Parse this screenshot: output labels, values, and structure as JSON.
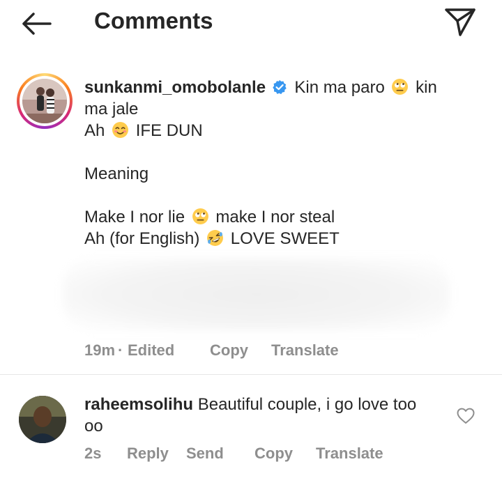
{
  "header": {
    "title": "Comments",
    "back_icon": "arrow-left-icon",
    "send_icon": "paper-plane-icon"
  },
  "post_comment": {
    "username": "sunkanmi_omobolanle",
    "verified": true,
    "text_part1": "Kin ma paro",
    "text_part2": "kin",
    "line2": "ma jale",
    "line3_a": "Ah",
    "line3_b": "IFE DUN",
    "line5": "Meaning",
    "line7_a": "Make I nor lie",
    "line7_b": "make I nor steal",
    "line8_a": "Ah (for English)",
    "line8_b": "LOVE SWEET",
    "emojis": [
      "rolling-eyes-emoji",
      "smiling-face-emoji",
      "rolling-eyes-emoji",
      "rofl-emoji"
    ],
    "time": "19m",
    "separator": "·",
    "edited": "Edited",
    "copy": "Copy",
    "translate": "Translate"
  },
  "reply_comment": {
    "username": "raheemsolihu",
    "text": "Beautiful couple, i go love too",
    "text_line2": "oo",
    "time": "2s",
    "reply": "Reply",
    "send": "Send",
    "copy": "Copy",
    "translate": "Translate",
    "like_icon": "heart-outline-icon"
  },
  "colors": {
    "text": "#262626",
    "meta": "#8e8e8e",
    "verified": "#3897f0",
    "divider": "#e6e6e6"
  }
}
